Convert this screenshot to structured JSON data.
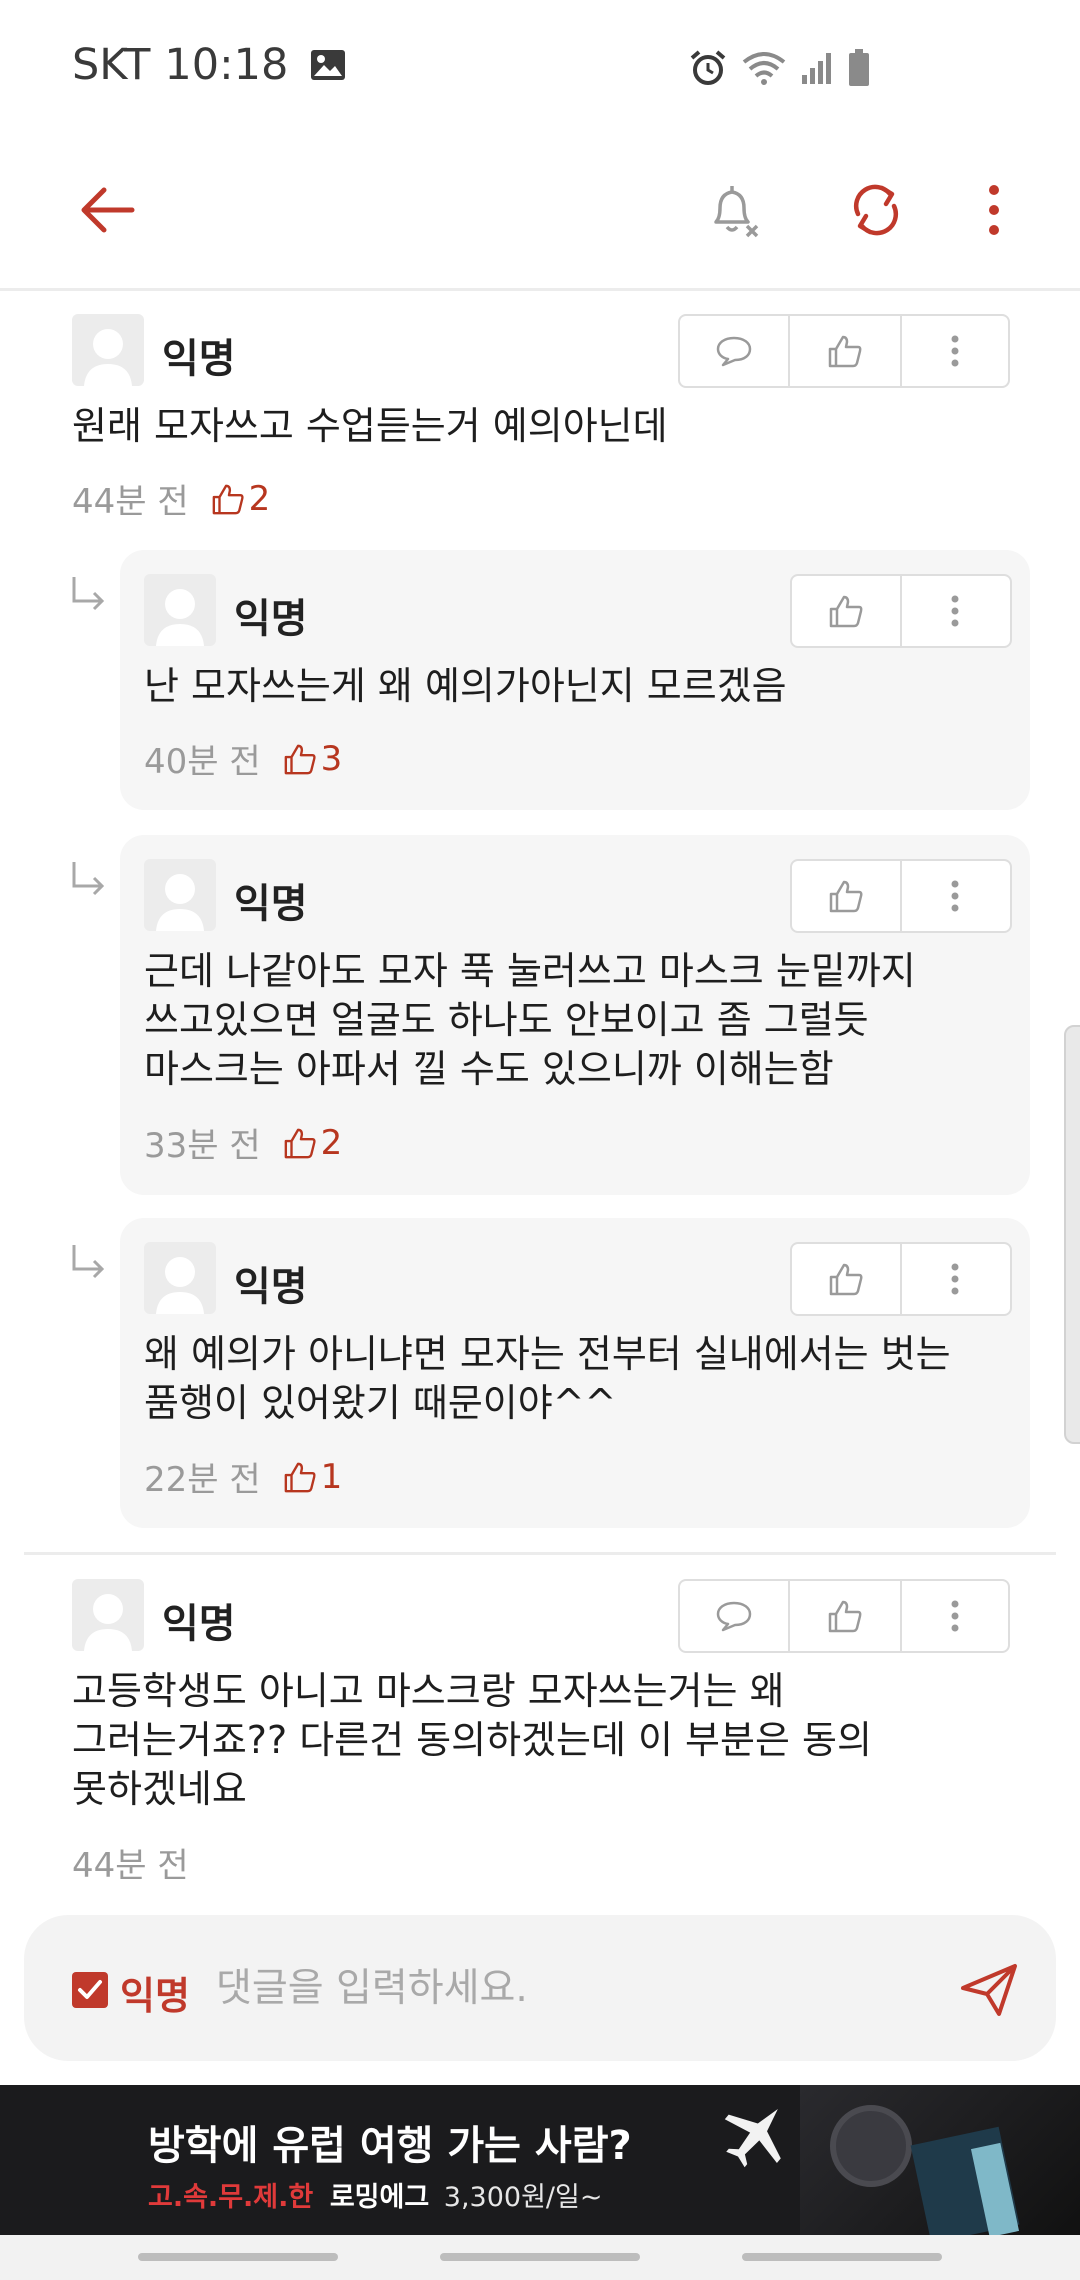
{
  "status_bar": {
    "carrier": "SKT",
    "time": "10:18"
  },
  "app_bar": {
    "accent": "#c0392b"
  },
  "comments": [
    {
      "author": "익명",
      "text": "원래 모자쓰고 수업듣는거 예의아닌데",
      "time": "44분 전",
      "likes": "2"
    },
    {
      "author": "익명",
      "text": "고등학생도 아니고 마스크랑 모자쓰는거는 왜\n그러는거죠?? 다른건 동의하겠는데 이 부분은 동의\n못하겠네요",
      "time": "44분 전",
      "likes": ""
    }
  ],
  "replies": [
    {
      "author": "익명",
      "text": "난 모자쓰는게 왜 예의가아닌지 모르겠음",
      "time": "40분 전",
      "likes": "3"
    },
    {
      "author": "익명",
      "text": "근데 나같아도 모자 푹 눌러쓰고 마스크 눈밑까지\n쓰고있으면 얼굴도 하나도 안보이고 좀 그럴듯\n마스크는 아파서 낄 수도 있으니까 이해는함",
      "time": "33분 전",
      "likes": "2"
    },
    {
      "author": "익명",
      "text": "왜 예의가 아니냐면 모자는 전부터 실내에서는 벗는\n품행이 있어왔기 때문이야^^",
      "time": "22분 전",
      "likes": "1"
    }
  ],
  "input_bar": {
    "anonymous_label": "익명",
    "anonymous_checked": true,
    "placeholder": "댓글을 입력하세요."
  },
  "banner": {
    "title": "방학에 유럽 여행 가는 사람?",
    "sub_red": "고.속.무.제.한",
    "sub_bold": "로밍에그",
    "sub_price": "3,300원/일~"
  }
}
